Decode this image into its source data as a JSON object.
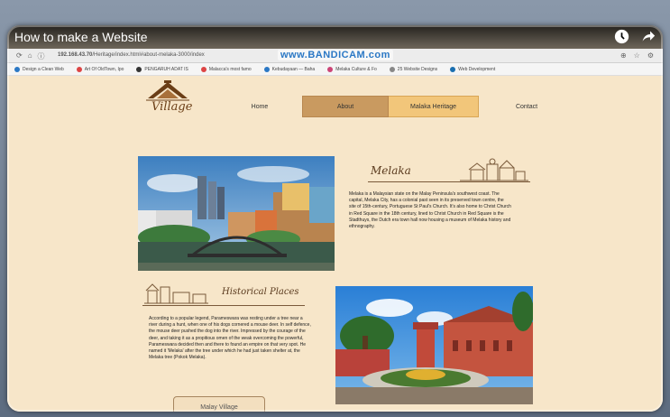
{
  "video": {
    "title": "How to make a Website"
  },
  "browser": {
    "url": "192.168.43.70",
    "url_rest": "/Heritage/index.html#about-melaka-3000/index",
    "watermark": "www.BANDICAM.com",
    "bookmarks": [
      {
        "label": "Design a Clean Web",
        "color": "#2b78c5"
      },
      {
        "label": "Art Of OldTown, Ipo",
        "color": "#d44"
      },
      {
        "label": "PENGARUH ADAT IS",
        "color": "#333"
      },
      {
        "label": "Malacca's most famo",
        "color": "#d44"
      },
      {
        "label": "Kebudayaan — Baha",
        "color": "#2b78c5"
      },
      {
        "label": "Melaka Culture & Fo",
        "color": "#c47"
      },
      {
        "label": "25 Website Designs",
        "color": "#888"
      },
      {
        "label": "Web Development",
        "color": "#1a6fb0"
      }
    ]
  },
  "site": {
    "logo_text": "Village",
    "nav": {
      "home": "Home",
      "about": "About",
      "heritage": "Malaka Heritage",
      "contact": "Contact"
    },
    "melaka": {
      "title": "Melaka",
      "body": "Melaka is a Malaysian state on the Malay Peninsula's southwest coast. The capital, Melaka City, has a colonial past seen in its preserved town centre, the site of 15th-century, Portuguese St Paul's Church. It's also home to Christ Church in Red Square in the 18th century, lined to Christ Church in Red Square is the Stadthuys, the Dutch era town hall now housing a museum of Melaka history and ethnography."
    },
    "historical": {
      "title": "Historical Places",
      "body": "According to a popular legend, Parameswara was resting under a tree near a river during a hunt, when one of his dogs cornered a mouse deer. In self defence, the mouse deer pushed the dog into the river. Impressed by the courage of the deer, and taking it as a propitious omen of the weak overcoming the powerful, Parameswara decided then and there to found an empire on that very spot. He named it 'Melaka' after the tree under which he had just taken shelter at, the Melaka tree (Pokok Melaka)."
    },
    "button": "Malay Village"
  },
  "colors": {
    "background": "#f7e6c9",
    "nav_about": "#c99a60",
    "nav_heritage": "#f2c67a",
    "heading": "#5a3a1e"
  }
}
